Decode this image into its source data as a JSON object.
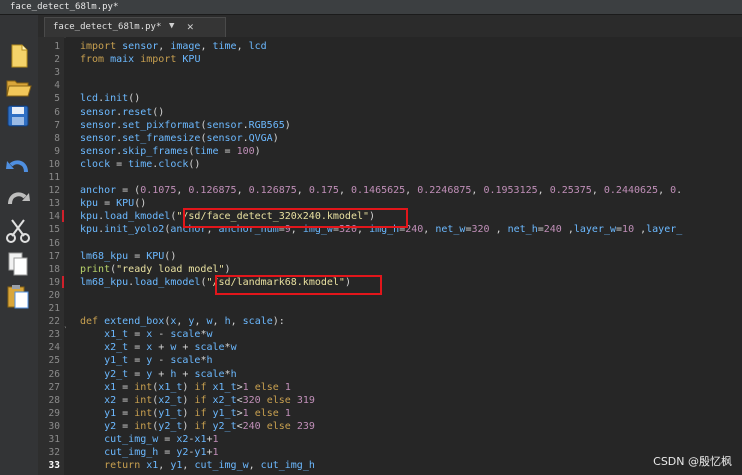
{
  "window": {
    "tab_title": "face_detect_68lm.py*"
  },
  "editor": {
    "tab": {
      "name": "face_detect_68lm.py*",
      "dropdown": "▼",
      "close": "✕"
    },
    "current_line": 33,
    "lines": [
      {
        "n": "1",
        "t": "import sensor, image, time, lcd"
      },
      {
        "n": "2",
        "t": "from maix import KPU"
      },
      {
        "n": "3",
        "t": ""
      },
      {
        "n": "4",
        "t": ""
      },
      {
        "n": "5",
        "t": "lcd.init()"
      },
      {
        "n": "6",
        "t": "sensor.reset()"
      },
      {
        "n": "7",
        "t": "sensor.set_pixformat(sensor.RGB565)"
      },
      {
        "n": "8",
        "t": "sensor.set_framesize(sensor.QVGA)"
      },
      {
        "n": "9",
        "t": "sensor.skip_frames(time = 100)"
      },
      {
        "n": "10",
        "t": "clock = time.clock()"
      },
      {
        "n": "11",
        "t": ""
      },
      {
        "n": "12",
        "t": "anchor = (0.1075, 0.126875, 0.126875, 0.175, 0.1465625, 0.2246875, 0.1953125, 0.25375, 0.2440625, 0."
      },
      {
        "n": "13",
        "t": "kpu = KPU()"
      },
      {
        "n": "14",
        "t": "kpu.load_kmodel(\"/sd/face_detect_320x240.kmodel\")"
      },
      {
        "n": "15",
        "t": "kpu.init_yolo2(anchor, anchor_num=9, img_w=320, img_h=240, net_w=320 , net_h=240 ,layer_w=10 ,layer_"
      },
      {
        "n": "16",
        "t": ""
      },
      {
        "n": "17",
        "t": "lm68_kpu = KPU()"
      },
      {
        "n": "18",
        "t": "print(\"ready load model\")"
      },
      {
        "n": "19",
        "t": "lm68_kpu.load_kmodel(\"/sd/landmark68.kmodel\")"
      },
      {
        "n": "20",
        "t": ""
      },
      {
        "n": "21",
        "t": ""
      },
      {
        "n": "22",
        "t": "def extend_box(x, y, w, h, scale):"
      },
      {
        "n": "23",
        "t": "    x1_t = x - scale*w"
      },
      {
        "n": "24",
        "t": "    x2_t = x + w + scale*w"
      },
      {
        "n": "25",
        "t": "    y1_t = y - scale*h"
      },
      {
        "n": "26",
        "t": "    y2_t = y + h + scale*h"
      },
      {
        "n": "27",
        "t": "    x1 = int(x1_t) if x1_t>1 else 1"
      },
      {
        "n": "28",
        "t": "    x2 = int(x2_t) if x2_t<320 else 319"
      },
      {
        "n": "29",
        "t": "    y1 = int(y1_t) if y1_t>1 else 1"
      },
      {
        "n": "30",
        "t": "    y2 = int(y2_t) if y2_t<240 else 239"
      },
      {
        "n": "31",
        "t": "    cut_img_w = x2-x1+1"
      },
      {
        "n": "32",
        "t": "    cut_img_h = y2-y1+1"
      },
      {
        "n": "33",
        "t": "    return x1, y1, cut_img_w, cut_img_h"
      }
    ]
  },
  "toolbar": [
    {
      "name": "new-file-button",
      "icon": "new-file-icon"
    },
    {
      "name": "open-file-button",
      "icon": "open-folder-icon"
    },
    {
      "name": "save-button",
      "icon": "save-icon"
    },
    {
      "name": "undo-button",
      "icon": "undo-icon"
    },
    {
      "name": "redo-button",
      "icon": "redo-icon"
    },
    {
      "name": "cut-button",
      "icon": "scissors-icon"
    },
    {
      "name": "copy-button",
      "icon": "copy-icon"
    },
    {
      "name": "paste-button",
      "icon": "paste-icon"
    }
  ],
  "watermark": "CSDN @殷忆枫"
}
